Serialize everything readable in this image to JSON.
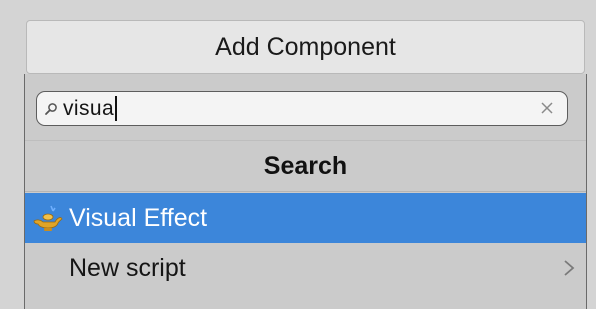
{
  "add_component": {
    "label": "Add Component"
  },
  "search": {
    "value": "visua",
    "icon": "search-icon",
    "clear_icon": "close-icon"
  },
  "results": {
    "header": "Search",
    "items": [
      {
        "label": "Visual Effect",
        "icon": "visual-effect-lamp-icon",
        "selected": true
      },
      {
        "label": "New script",
        "icon": "chevron-right-icon",
        "selected": false
      }
    ]
  },
  "colors": {
    "selection": "#3c86da",
    "panel": "#cbcbcb",
    "background": "#d4d4d4"
  }
}
